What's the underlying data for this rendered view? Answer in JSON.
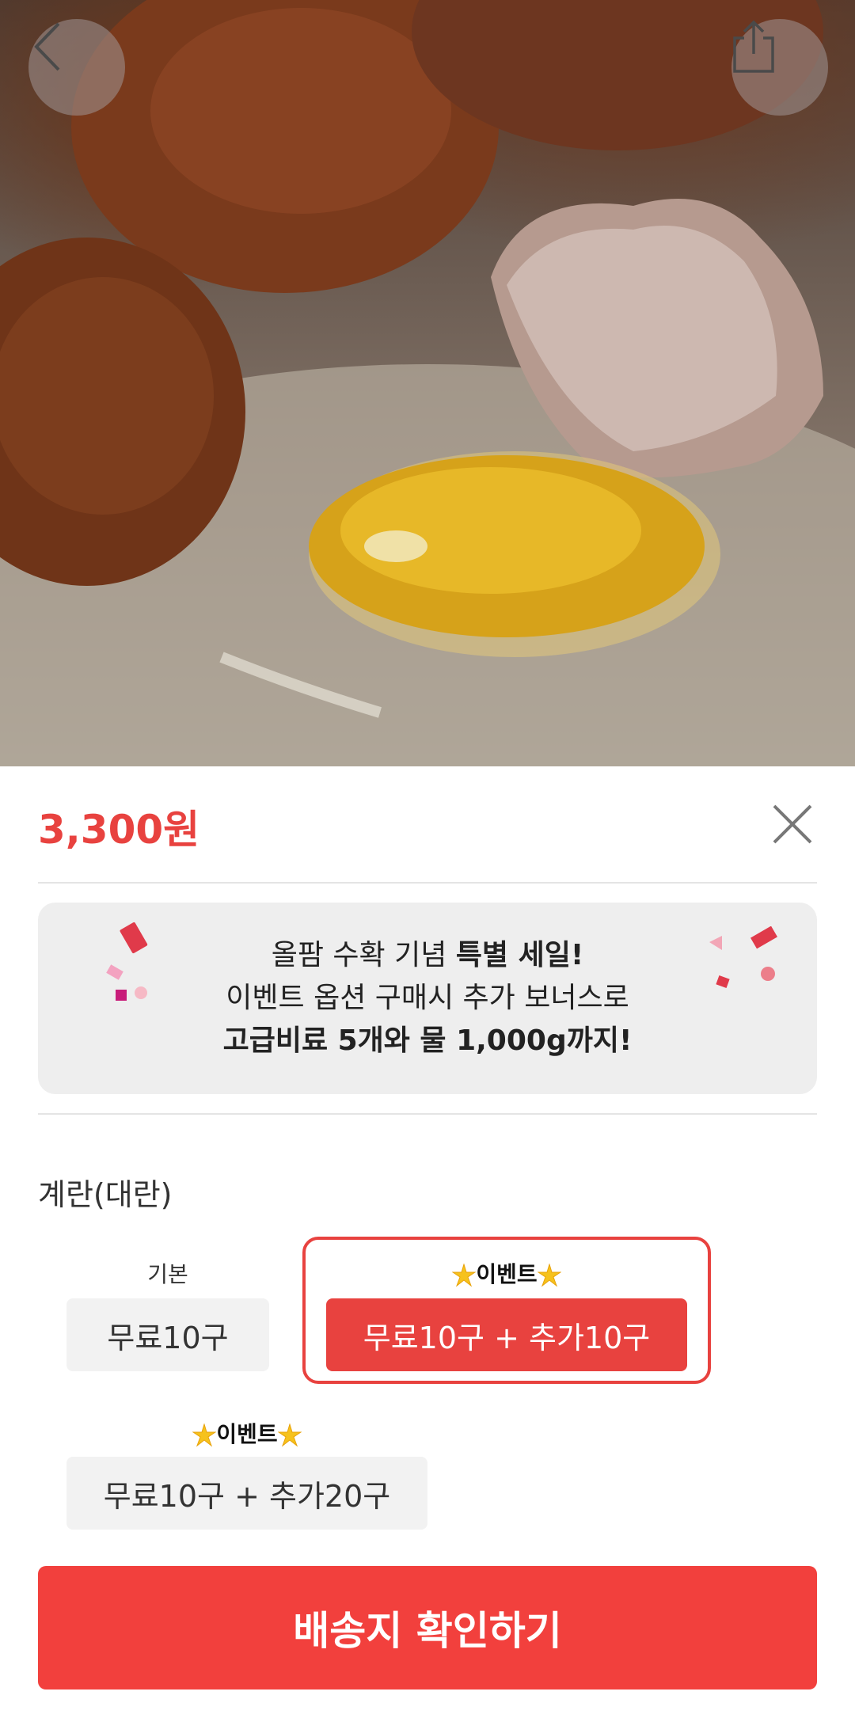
{
  "product": {
    "price": "3,300원"
  },
  "banner": {
    "line1_normal": "올팜 수확 기념 ",
    "line1_bold": "특별 세일!",
    "line2": "이벤트 옵션 구매시 추가 보너스로",
    "line3": "고급비료 5개와 물 1,000g까지!"
  },
  "options": {
    "title": "계란(대란)",
    "items": [
      {
        "tag": "기본",
        "label": "무료10구",
        "selected": false
      },
      {
        "tag": "이벤트",
        "label": "무료10구 + 추가10구",
        "selected": true
      },
      {
        "tag": "이벤트",
        "label": "무료10구 + 추가20구",
        "selected": false
      }
    ]
  },
  "cta": {
    "label": "배송지 확인하기"
  },
  "colors": {
    "accent": "#e8423f",
    "cta": "#f2403d",
    "banner_bg": "#eeeeee",
    "option_bg": "#f2f2f2"
  },
  "icons": [
    "back-arrow-icon",
    "share-icon",
    "close-icon",
    "sparkle-star-icon",
    "confetti-icon"
  ]
}
